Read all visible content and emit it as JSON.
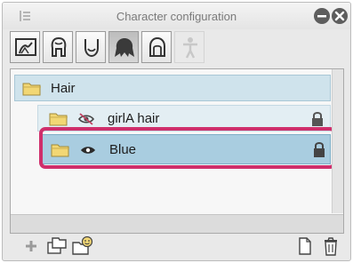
{
  "window": {
    "title": "Character configuration"
  },
  "toolbar": {
    "buttons": [
      {
        "name": "body-shape-tab",
        "icon": "figure-frame-icon",
        "active": false
      },
      {
        "name": "hair-back-tab",
        "icon": "hair-back-icon",
        "active": false
      },
      {
        "name": "face-tab",
        "icon": "face-icon",
        "active": false
      },
      {
        "name": "hair-tab",
        "icon": "hair-silhouette-icon",
        "active": true
      },
      {
        "name": "headwear-tab",
        "icon": "headwear-icon",
        "active": false
      },
      {
        "name": "pose-tab",
        "icon": "human-figure-icon",
        "active": false,
        "disabled": true
      }
    ]
  },
  "layers": {
    "items": [
      {
        "label": "Hair",
        "icon": "folder-icon",
        "visible_icon": "",
        "locked": false
      },
      {
        "label": "girlA hair",
        "icon": "folder-icon",
        "visible_icon": "eye-hidden-icon",
        "locked": true
      },
      {
        "label": "Blue",
        "icon": "folder-icon",
        "visible_icon": "eye-icon",
        "locked": true,
        "selected": true
      }
    ]
  },
  "colors": {
    "highlight": "#cf2f6b",
    "selected_row": "#a9cde0",
    "parent_row": "#cfe3ec",
    "folder": "#f2d774"
  }
}
